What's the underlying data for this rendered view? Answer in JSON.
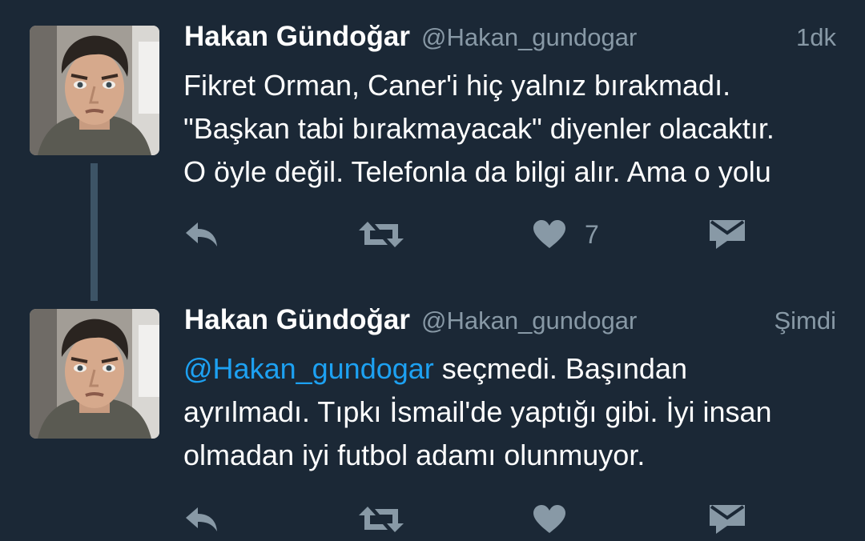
{
  "colors": {
    "background": "#1b2836",
    "text": "#ffffff",
    "secondary_text": "#8899a6",
    "mention": "#1da1f2",
    "icons": "#8899a6",
    "thread_line": "#3d5466"
  },
  "tweets": [
    {
      "author_name": "Hakan Gündoğar",
      "handle": "@Hakan_gundogar",
      "time": "1dk",
      "text_lines": [
        "Fikret Orman, Caner'i hiç yalnız bırakmadı.",
        "\"Başkan tabi bırakmayacak\" diyenler olacaktır.",
        "O öyle değil. Telefonla da bilgi alır. Ama o yolu"
      ],
      "like_count": "7",
      "actions": [
        "reply-icon",
        "retweet-icon",
        "heart-icon",
        "direct-message-icon"
      ]
    },
    {
      "author_name": "Hakan Gündoğar",
      "handle": "@Hakan_gundogar",
      "time": "Şimdi",
      "mention": "@Hakan_gundogar",
      "first_line_rest": " seçmedi. Başından",
      "text_lines": [
        "ayrılmadı. Tıpkı İsmail'de yaptığı gibi. İyi insan",
        "olmadan iyi futbol adamı olunmuyor."
      ],
      "actions": [
        "reply-icon",
        "retweet-icon",
        "heart-icon",
        "direct-message-icon"
      ]
    }
  ]
}
